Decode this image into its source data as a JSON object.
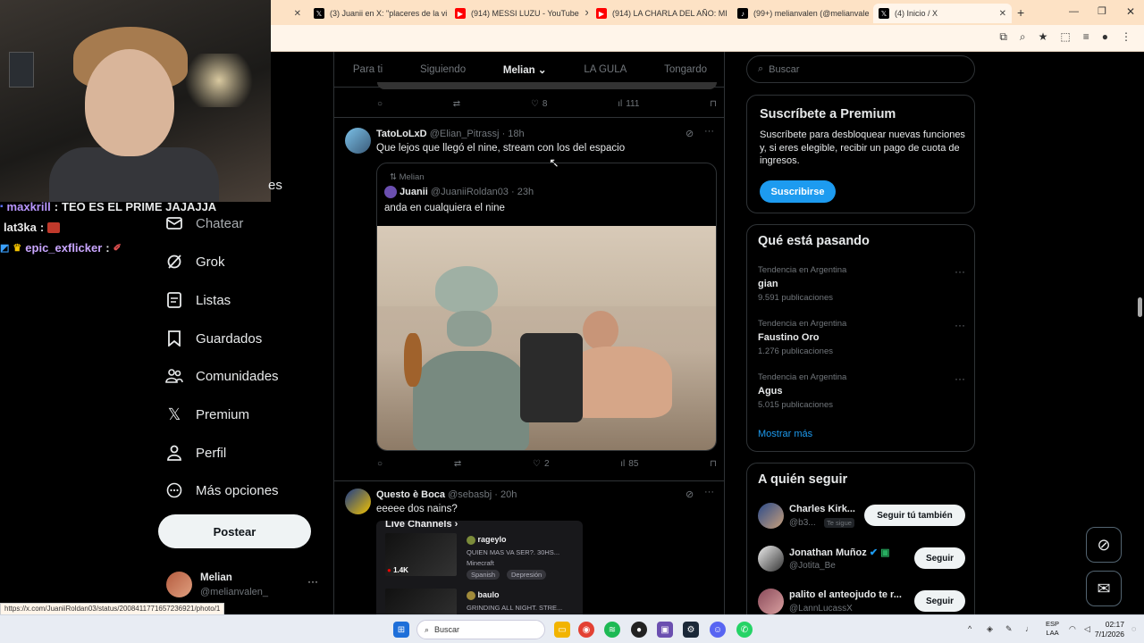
{
  "browser": {
    "tabs": [
      {
        "title": "(3) Juanii en X: \"placeres de la vi",
        "icon": "x-logo-icon",
        "color": "#000000"
      },
      {
        "title": "(914) MESSI LUZU - YouTube",
        "icon": "youtube-icon",
        "color": "#ff0000"
      },
      {
        "title": "(914) LA CHARLA DEL AÑO: MI",
        "icon": "youtube-icon",
        "color": "#ff0000"
      },
      {
        "title": "(99+) melianvalen (@melianvale",
        "icon": "tiktok-icon",
        "color": "#000000"
      },
      {
        "title": "(4) Inicio / X",
        "icon": "x-logo-icon",
        "color": "#000000"
      }
    ],
    "status_url": "https://x.com/JuaniiRoldan03/status/2008411771657236921/photo/1"
  },
  "stream_chat": [
    {
      "user": "maxkrill",
      "text": "TEO ES EL PRIME JAJAJJA",
      "color": "#b996ff"
    },
    {
      "user": "lat3ka",
      "text": "",
      "color": "#e8e8e8"
    },
    {
      "user": "epic_exflicker",
      "text": "",
      "color": "#c9a6ff"
    }
  ],
  "sidebar": {
    "partial_label": "es",
    "items": [
      {
        "label": "Chatear",
        "icon": "mail-icon"
      },
      {
        "label": "Grok",
        "icon": "grok-icon"
      },
      {
        "label": "Listas",
        "icon": "list-icon"
      },
      {
        "label": "Guardados",
        "icon": "bookmark-icon"
      },
      {
        "label": "Comunidades",
        "icon": "communities-icon"
      },
      {
        "label": "Premium",
        "icon": "x-logo-icon"
      },
      {
        "label": "Perfil",
        "icon": "person-icon"
      },
      {
        "label": "Más opciones",
        "icon": "more-circle-icon"
      }
    ],
    "post_button": "Postear",
    "profile": {
      "name": "Melian",
      "handle": "@melianvalen_"
    }
  },
  "feed": {
    "tabs": [
      "Para ti",
      "Siguiendo",
      "Melian",
      "LA GULA",
      "Tongardo"
    ],
    "active_tab": "Melian",
    "prev_tweet_actions": {
      "likes": "8",
      "views": "111"
    },
    "tweet1": {
      "name": "TatoLoLxD",
      "handle": "@Elian_Pitrassj",
      "time": "· 18h",
      "text": "Que lejos que llegó el nine, stream con los del espacio",
      "quote": {
        "reposted_by": "Melian",
        "name": "Juanii",
        "handle": "@JuaniiRoldan03",
        "time": "· 23h",
        "text": "anda en cualquiera el nine"
      },
      "likes": "2",
      "views": "85"
    },
    "tweet2": {
      "name": "Questo è Boca",
      "handle": "@sebasbj",
      "time": "· 20h",
      "text": "eeeee dos nains?",
      "embed_title": "Live Channels",
      "channels": [
        {
          "name": "rageylo",
          "title": "QUIEN MAS VA SER?. 30HS...",
          "game": "Minecraft",
          "tags": [
            "Spanish",
            "Depresión"
          ],
          "viewers": "1.4K"
        },
        {
          "name": "baulo",
          "title": "GRINDING ALL NIGHT. STRE..."
        }
      ]
    }
  },
  "right": {
    "search_placeholder": "Buscar",
    "premium": {
      "title": "Suscríbete a Premium",
      "text": "Suscríbete para desbloquear nuevas funciones y, si eres elegible, recibir un pago de cuota de ingresos.",
      "button": "Suscribirse"
    },
    "trends": {
      "title": "Qué está pasando",
      "items": [
        {
          "context": "Tendencia en Argentina",
          "name": "gian",
          "count": "9.591 publicaciones"
        },
        {
          "context": "Tendencia en Argentina",
          "name": "Faustino Oro",
          "count": "1.276 publicaciones"
        },
        {
          "context": "Tendencia en Argentina",
          "name": "Agus",
          "count": "5.015 publicaciones"
        }
      ],
      "more": "Mostrar más"
    },
    "who_to_follow": {
      "title": "A quién seguir",
      "items": [
        {
          "name": "Charles Kirk...",
          "handle": "@b3...",
          "badge": "Te sigue",
          "button": "Seguir tú también"
        },
        {
          "name": "Jonathan Muñoz",
          "handle": "@Jotita_Be",
          "button": "Seguir"
        },
        {
          "name": "palito el anteojudo te r...",
          "handle": "@LannLucassX",
          "button": "Seguir"
        }
      ]
    }
  },
  "taskbar": {
    "search": "Buscar",
    "lang": "ESP",
    "lang2": "LAA",
    "time": "02:17",
    "date": "7/1/2026"
  }
}
